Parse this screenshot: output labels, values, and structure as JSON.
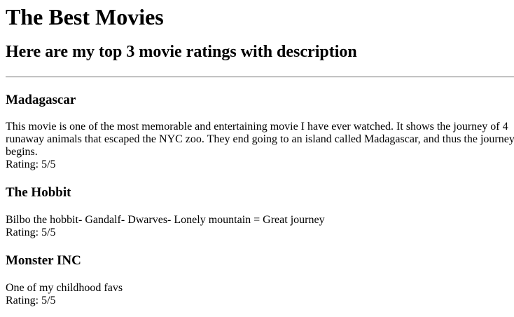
{
  "page": {
    "title": "The Best Movies",
    "subtitle": "Here are my top 3 movie ratings with description"
  },
  "movies": [
    {
      "title": "Madagascar",
      "description": "This movie is one of the most memorable and entertaining movie I have ever watched. It shows the journey of 4 runaway animals that escaped the NYC zoo. They end going to an island called Madagascar, and thus the journey begins.",
      "rating": "Rating: 5/5"
    },
    {
      "title": "The Hobbit",
      "description": "Bilbo the hobbit- Gandalf- Dwarves- Lonely mountain = Great journey",
      "rating": "Rating: 5/5"
    },
    {
      "title": "Monster INC",
      "description": "One of my childhood favs",
      "rating": "Rating: 5/5"
    }
  ]
}
